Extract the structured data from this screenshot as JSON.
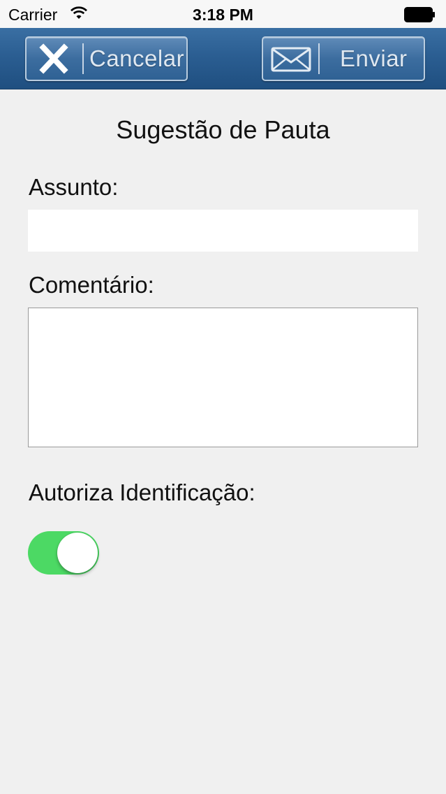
{
  "status_bar": {
    "carrier": "Carrier",
    "time": "3:18 PM",
    "wifi_icon": "wifi-icon",
    "battery_icon": "battery-full-icon"
  },
  "toolbar": {
    "cancel_label": "Cancelar",
    "cancel_icon": "close-x-icon",
    "send_label": "Enviar",
    "send_icon": "envelope-icon",
    "background_color": "#2b5e92"
  },
  "form": {
    "title": "Sugestão de Pauta",
    "subject_label": "Assunto:",
    "subject_value": "",
    "comment_label": "Comentário:",
    "comment_value": "",
    "authorize_label": "Autoriza Identificação:",
    "authorize_on": true,
    "toggle_on_color": "#4cd964"
  }
}
